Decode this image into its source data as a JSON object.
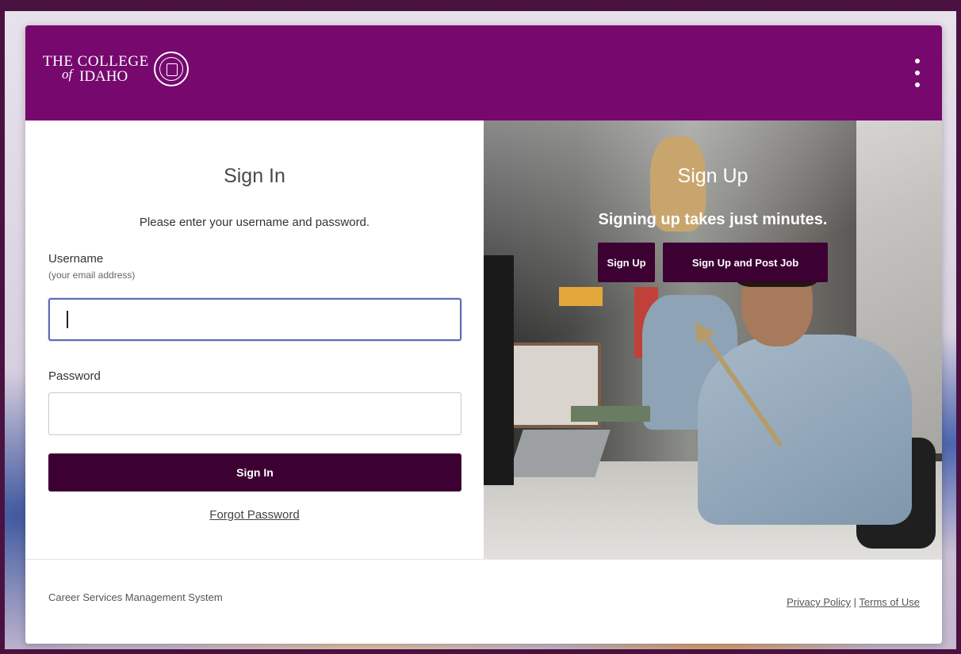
{
  "header": {
    "logo_line1": "THE COLLEGE",
    "logo_of": "of",
    "logo_line2": "IDAHO",
    "menu_icon": "kebab-menu-icon",
    "bg_color": "#76086e"
  },
  "signin": {
    "title": "Sign In",
    "subtitle": "Please enter your username and password.",
    "username_label": "Username",
    "username_hint": "(your email address)",
    "username_value": "",
    "password_label": "Password",
    "password_value": "",
    "button_label": "Sign In",
    "forgot_label": "Forgot Password",
    "button_color": "#3d0033"
  },
  "signup": {
    "title": "Sign Up",
    "subtitle": "Signing up takes just minutes.",
    "button1": "Sign Up",
    "button2": "Sign Up and Post Job",
    "arrow_color": "#b59b6a"
  },
  "footer": {
    "left_text": "Career Services Management System",
    "privacy": "Privacy Policy",
    "separator": "|",
    "terms": "Terms of Use"
  }
}
